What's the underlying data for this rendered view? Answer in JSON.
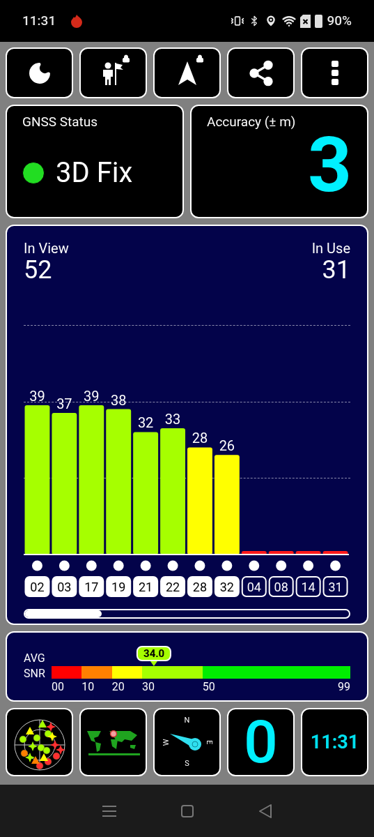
{
  "status_bar": {
    "time": "11:31",
    "battery": "90%"
  },
  "toolbar": [
    {
      "kind": "moon",
      "locked": false
    },
    {
      "kind": "person-flag",
      "locked": true
    },
    {
      "kind": "arrow",
      "locked": true
    },
    {
      "kind": "share",
      "locked": false
    },
    {
      "kind": "more",
      "locked": false
    }
  ],
  "gnss_status": {
    "title": "GNSS Status",
    "fix": "3D Fix",
    "color": "#22dd22"
  },
  "accuracy": {
    "title": "Accuracy (± m)",
    "value": "3"
  },
  "satellites_panel": {
    "in_view_label": "In View",
    "in_view": "52",
    "in_use_label": "In Use",
    "in_use": "31",
    "chart_data": {
      "type": "bar",
      "categories": [
        "02",
        "03",
        "17",
        "19",
        "21",
        "22",
        "28",
        "32",
        "04",
        "08",
        "14",
        "31"
      ],
      "values": [
        39,
        37,
        39,
        38,
        32,
        33,
        28,
        26,
        0,
        0,
        0,
        0
      ],
      "value_labels": [
        "39",
        "37",
        "39",
        "38",
        "32",
        "33",
        "28",
        "26",
        null,
        null,
        null,
        null
      ]
    },
    "satellites": [
      {
        "used": true
      },
      {
        "used": true
      },
      {
        "used": true
      },
      {
        "used": true
      },
      {
        "used": true
      },
      {
        "used": true
      },
      {
        "used": true
      },
      {
        "used": true
      },
      {
        "used": false
      },
      {
        "used": false
      },
      {
        "used": false
      },
      {
        "used": false
      }
    ]
  },
  "snr": {
    "label_1": "AVG",
    "label_2": "SNR",
    "reading": "34.0",
    "segments": [
      {
        "color": "#ff0000"
      },
      {
        "color": "#ff8000"
      },
      {
        "color": "#ffff00"
      },
      {
        "color": "#a6ff00"
      },
      {
        "color": "#00ee00"
      }
    ],
    "ticks": [
      "00",
      "10",
      "20",
      "30",
      "50",
      "99"
    ]
  },
  "tiles": {
    "compass": [
      "N",
      "E",
      "S",
      "W"
    ],
    "counter": "0",
    "clock": "11:31"
  }
}
